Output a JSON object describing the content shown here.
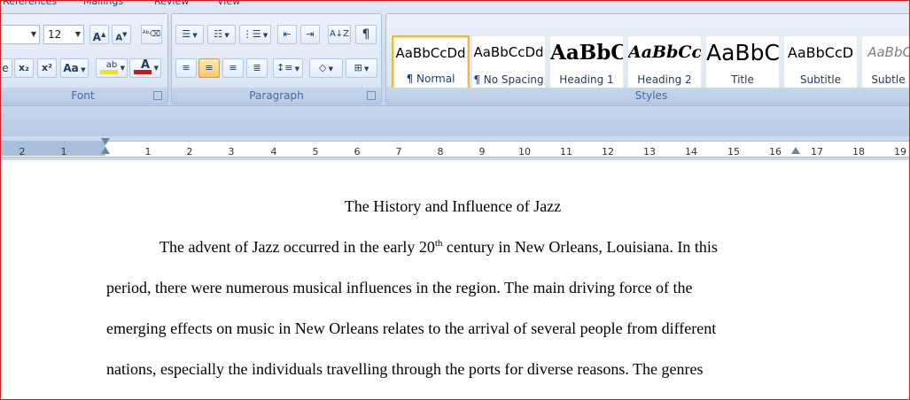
{
  "tabs": [
    {
      "label": "References"
    },
    {
      "label": "Mailings"
    },
    {
      "label": "Review"
    },
    {
      "label": "View"
    }
  ],
  "font_group": {
    "title": "Font",
    "font_size": "12",
    "grow_font_icon": "grow-font-icon",
    "shrink_font_icon": "shrink-font-icon",
    "clear_format_icon": "clear-format-icon",
    "subscript_label": "x₂",
    "superscript_label": "x²",
    "change_case_label": "Aa",
    "highlight_label": "ab",
    "font_color_label": "A",
    "highlight_color": "#f5e400",
    "font_color": "#e01010"
  },
  "paragraph_group": {
    "title": "Paragraph",
    "pilcrow": "¶",
    "sort_icon": "sort-az-icon"
  },
  "styles_group": {
    "title": "Styles",
    "items": [
      {
        "preview": "AaBbCcDd",
        "label": "¶ Normal"
      },
      {
        "preview": "AaBbCcDd",
        "label": "¶ No Spacing"
      },
      {
        "preview": "AaBbC",
        "label": "Heading 1"
      },
      {
        "preview": "AaBbCc",
        "label": "Heading 2"
      },
      {
        "preview": "AaBbC",
        "label": "Title"
      },
      {
        "preview": "AaBbCcD",
        "label": "Subtitle"
      },
      {
        "preview": "AaBbCcD",
        "label": "Subtle Em"
      }
    ]
  },
  "ruler": {
    "left_numbers": [
      "2",
      "1"
    ],
    "numbers": [
      "1",
      "2",
      "3",
      "4",
      "5",
      "6",
      "7",
      "8",
      "9",
      "10",
      "11",
      "12",
      "13",
      "14",
      "15",
      "16",
      "17",
      "18",
      "19"
    ]
  },
  "document": {
    "title": "The History and Influence of Jazz",
    "para_line1_a": "The advent of Jazz occurred in the early 20",
    "para_line1_sup": "th",
    "para_line1_b": " century in New Orleans, Louisiana. In this",
    "line2": "period, there were numerous musical influences in the region. The main driving force of the",
    "line3": "emerging effects on music in New Orleans relates to the arrival of several people from different",
    "line4": "nations, especially the individuals travelling through the ports for diverse reasons. The genres"
  }
}
